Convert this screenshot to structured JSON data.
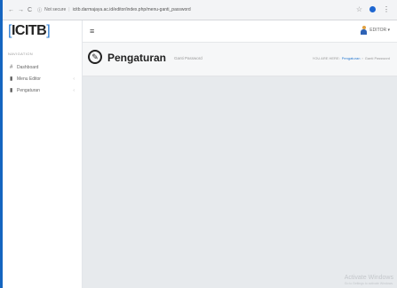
{
  "browser": {
    "nav_icons": [
      "←",
      "→",
      "C"
    ],
    "security": "Not secure",
    "url": "icitb.darmajaya.ac.id/editor/index.php/menu-ganti_password"
  },
  "app": {
    "logo": "ICITB",
    "logo_bracket_left": "[",
    "logo_bracket_right": "]"
  },
  "sidebar": {
    "header": "NAVIGATION",
    "items": [
      {
        "icon": "#",
        "label": "Dashboard",
        "chevron": ""
      },
      {
        "icon": "▮",
        "label": "Menu Editor",
        "chevron": "‹"
      },
      {
        "icon": "▮",
        "label": "Pengaturan",
        "chevron": "‹"
      }
    ]
  },
  "header": {
    "menu_icon": "≡",
    "user": "EDITOR ▾"
  },
  "page": {
    "title": "Pengaturan",
    "subtitle": "Ganti Password",
    "breadcrumb": {
      "prefix": "YOU ARE HERE:",
      "link": "Pengaturan",
      "separator": "›",
      "current": "Ganti Password"
    }
  },
  "watermark": {
    "line1": "Activate Windows",
    "line2": "Go to Settings to activate Windows."
  },
  "colors": {
    "accent": "#2b7bd0",
    "edge": "#1565c0",
    "content_bg": "#e7eaed"
  }
}
